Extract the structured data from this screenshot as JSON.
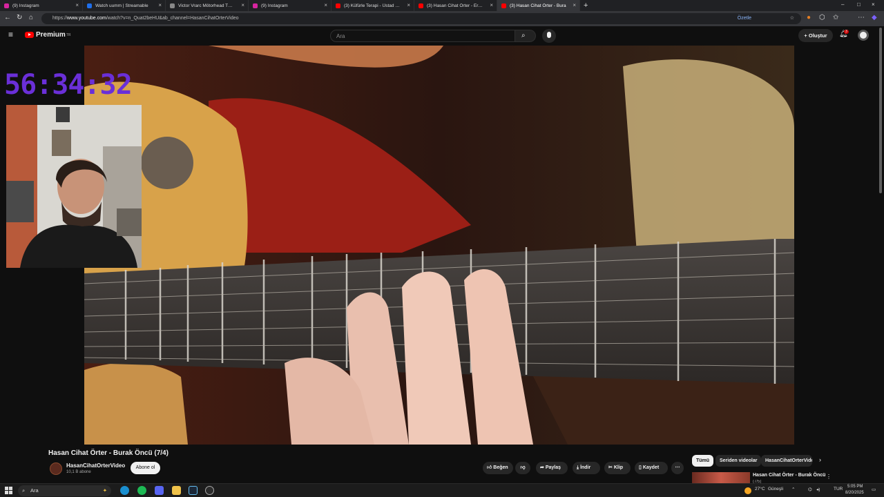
{
  "browser": {
    "tabs": [
      {
        "label": "(9) Instagram",
        "fav": "#d6249f"
      },
      {
        "label": "Watch uumm | Streamable",
        "fav": "#1f6feb"
      },
      {
        "label": "Victor Vrarc Mötorhead Through",
        "fav": "#888888"
      },
      {
        "label": "(9) Instagram",
        "fav": "#d6249f"
      },
      {
        "label": "(3) Küfürle Terapi - Üstad Dr. Has",
        "fav": "#ff0000"
      },
      {
        "label": "(3) Hasan Cihat Örter - Erkin",
        "fav": "#ff0000"
      },
      {
        "label": "(3) Hasan Cihat Örter - Bura",
        "fav": "#ff0000"
      }
    ],
    "url_prefix": "https://",
    "url_domain": "www.youtube.com",
    "url_path": "/watch?v=n_Quat2beHU&ab_channel=HasanCihatOrterVideo",
    "summarize_label": "Özetle"
  },
  "youtube": {
    "logo_text": "Premium",
    "logo_sup": "TR",
    "search_placeholder": "Ara",
    "create_label": "Oluştur",
    "notif_count": "3"
  },
  "overlay": {
    "timer": "56:34:32"
  },
  "video": {
    "title": "Hasan Cihat Örter - Burak Öncü (7/4)",
    "channel": "HasanCihatOrterVideo",
    "subscribers": "10,1 B abone",
    "subscribe_label": "Abone ol",
    "actions": {
      "like": "Beğen",
      "share": "Paylaş",
      "download": "İndir",
      "clip": "Klip",
      "save": "Kaydet"
    }
  },
  "related": {
    "chips": [
      "Tümü",
      "Seriden videolar",
      "HasanCihatOrterVideo"
    ],
    "first_title": "Hasan Cihat Örter - Burak Öncü",
    "first_sub": "(7/5)"
  },
  "taskbar": {
    "search_label": "Ara",
    "weather": "27°C",
    "weather_desc": "Güneşli",
    "lang": "TUR",
    "time": "5:05 PM",
    "date": "8/20/2025"
  }
}
